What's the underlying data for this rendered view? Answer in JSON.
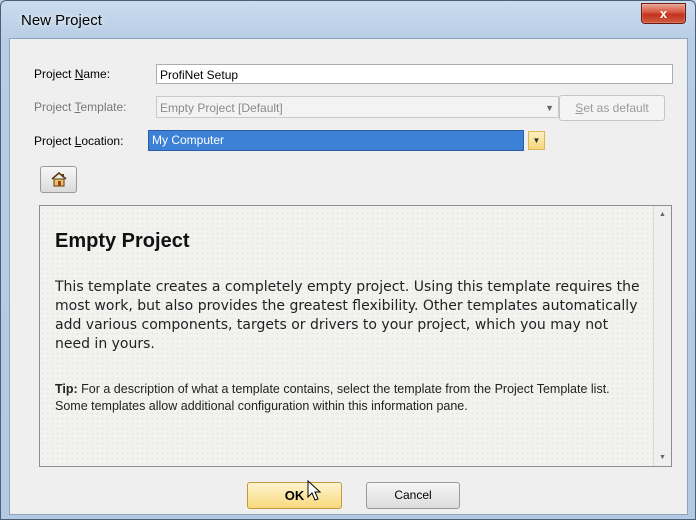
{
  "window": {
    "title": "New Project",
    "close_label": "x"
  },
  "form": {
    "name_label_pre": "Project ",
    "name_label_key": "N",
    "name_label_post": "ame:",
    "name_value": "ProfiNet Setup",
    "template_label_pre": "Project ",
    "template_label_key": "T",
    "template_label_post": "emplate:",
    "template_value": "Empty Project  [Default]",
    "set_default_key": "S",
    "set_default_rest": "et as default",
    "location_label_pre": "Project ",
    "location_label_key": "L",
    "location_label_post": "ocation:",
    "location_value": "My Computer"
  },
  "icons": {
    "home": "home-icon",
    "dropdown": "chevron-down-icon",
    "cursor": "mouse-pointer-icon"
  },
  "pane": {
    "heading": "Empty Project",
    "body": "This template creates a completely empty project. Using this template requires the most work, but also provides the greatest flexibility. Other templates automatically add various components, targets or drivers to your project, which you may not need in yours.",
    "tip_label": "Tip:",
    "tip_text": " For a description of what a template contains, select the template from the Project Template list. Some templates allow additional configuration within this information pane."
  },
  "buttons": {
    "ok": "OK",
    "cancel": "Cancel"
  },
  "colors": {
    "selection": "#3d81d6",
    "ok_button": "#f8d97c",
    "close_button": "#c2321e"
  }
}
